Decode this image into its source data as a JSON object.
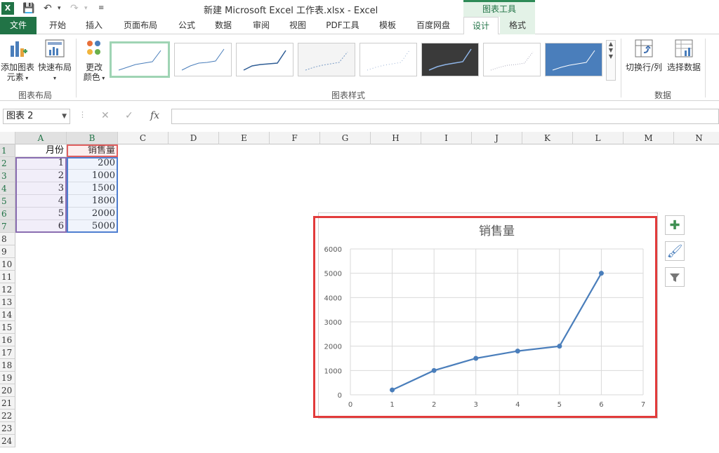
{
  "window": {
    "title": "新建 Microsoft Excel 工作表.xlsx - Excel",
    "app_logo": "X",
    "context_group": "图表工具"
  },
  "tabs": [
    {
      "label": "文件"
    },
    {
      "label": "开始"
    },
    {
      "label": "插入"
    },
    {
      "label": "页面布局"
    },
    {
      "label": "公式"
    },
    {
      "label": "数据"
    },
    {
      "label": "审阅"
    },
    {
      "label": "视图"
    },
    {
      "label": "PDF工具"
    },
    {
      "label": "模板"
    },
    {
      "label": "百度网盘"
    },
    {
      "label": "设计"
    },
    {
      "label": "格式"
    }
  ],
  "ribbon": {
    "add_element_line1": "添加图表",
    "add_element_line2": "元素",
    "quick_layout": "快速布局",
    "change_color_line1": "更改",
    "change_color_line2": "颜色",
    "group_layouts": "图表布局",
    "group_styles": "图表样式",
    "switch_row_col": "切换行/列",
    "select_data": "选择数据",
    "group_data": "数据"
  },
  "formula_bar": {
    "name_box": "图表 2",
    "fx": "fx",
    "value": ""
  },
  "columns": [
    "A",
    "B",
    "C",
    "D",
    "E",
    "F",
    "G",
    "H",
    "I",
    "J",
    "K",
    "L",
    "M",
    "N"
  ],
  "rows": [
    "1",
    "2",
    "3",
    "4",
    "5",
    "6",
    "7",
    "8",
    "9",
    "10",
    "11",
    "12",
    "13",
    "14",
    "15",
    "16",
    "17",
    "18",
    "19",
    "20",
    "21",
    "22",
    "23",
    "24"
  ],
  "table": {
    "header": [
      "月份",
      "销售量"
    ],
    "data": [
      [
        "1",
        "200"
      ],
      [
        "2",
        "1000"
      ],
      [
        "3",
        "1500"
      ],
      [
        "4",
        "1800"
      ],
      [
        "5",
        "2000"
      ],
      [
        "6",
        "5000"
      ]
    ]
  },
  "chart_data": {
    "type": "scatter",
    "title": "销售量",
    "x": [
      1,
      2,
      3,
      4,
      5,
      6
    ],
    "y": [
      200,
      1000,
      1500,
      1800,
      2000,
      5000
    ],
    "xlim": [
      0,
      7
    ],
    "ylim": [
      0,
      6000
    ],
    "xticks": [
      "0",
      "1",
      "2",
      "3",
      "4",
      "5",
      "6",
      "7"
    ],
    "yticks": [
      "0",
      "1000",
      "2000",
      "3000",
      "4000",
      "5000",
      "6000"
    ],
    "grid": true,
    "line_color": "#4a7ebb"
  },
  "icons": {
    "add": "plus-icon",
    "style": "brush-icon",
    "filter": "filter-icon"
  }
}
